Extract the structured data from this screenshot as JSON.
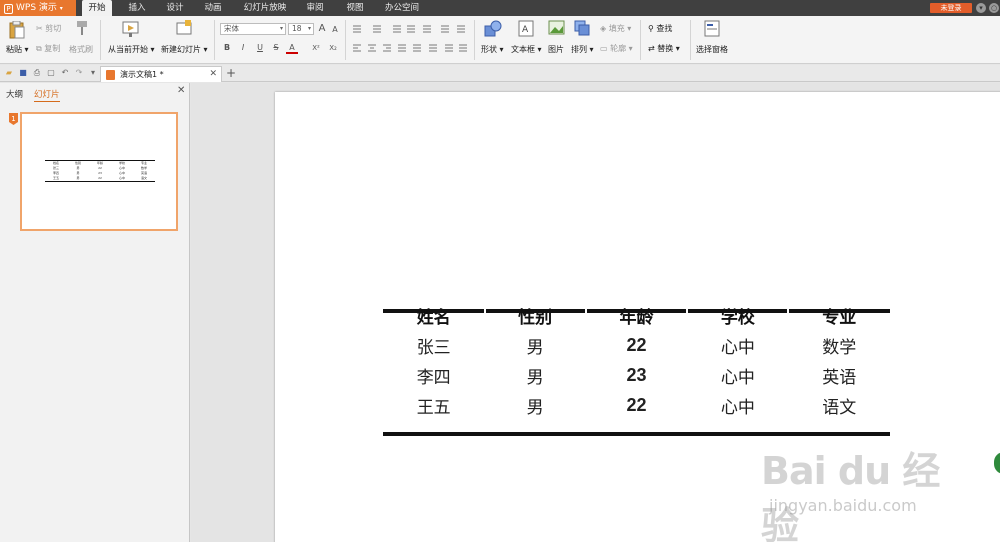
{
  "menu": {
    "app_name": "WPS 演示",
    "tabs": [
      "开始",
      "插入",
      "设计",
      "动画",
      "幻灯片放映",
      "审阅",
      "视图",
      "办公空间"
    ],
    "active_tab": "开始",
    "login_label": "未登录"
  },
  "ribbon": {
    "paste": "粘贴",
    "cut": "剪切",
    "copy": "复制",
    "format_painter": "格式刷",
    "from_start": "从当前开始",
    "new_slide": "新建幻灯片",
    "font_name": "宋体",
    "font_size": "18",
    "bold": "B",
    "italic": "I",
    "underline": "U",
    "strike": "S",
    "font_color": "A",
    "superscript": "X²",
    "subscript": "X₂",
    "shapes": "形状",
    "textbox": "文本框",
    "picture": "图片",
    "arrange": "排列",
    "fill": "填充",
    "outline": "轮廓",
    "find": "查找",
    "replace": "替换",
    "selection_pane": "选择窗格"
  },
  "document": {
    "tab_title": "演示文稿1 *"
  },
  "left_panel": {
    "tab_outline": "大纲",
    "tab_slides": "幻灯片",
    "slide_number": "1"
  },
  "table": {
    "headers": [
      "姓名",
      "性别",
      "年龄",
      "学校",
      "专业"
    ],
    "rows": [
      [
        "张三",
        "男",
        "22",
        "心中",
        "数学"
      ],
      [
        "李四",
        "男",
        "23",
        "心中",
        "英语"
      ],
      [
        "王五",
        "男",
        "22",
        "心中",
        "语文"
      ]
    ]
  },
  "watermark": {
    "logo": "Bai du 经验",
    "url": "jingyan.baidu.com"
  },
  "colors": {
    "accent": "#e8772e",
    "menubar": "#404040",
    "login": "#e35d2a"
  }
}
